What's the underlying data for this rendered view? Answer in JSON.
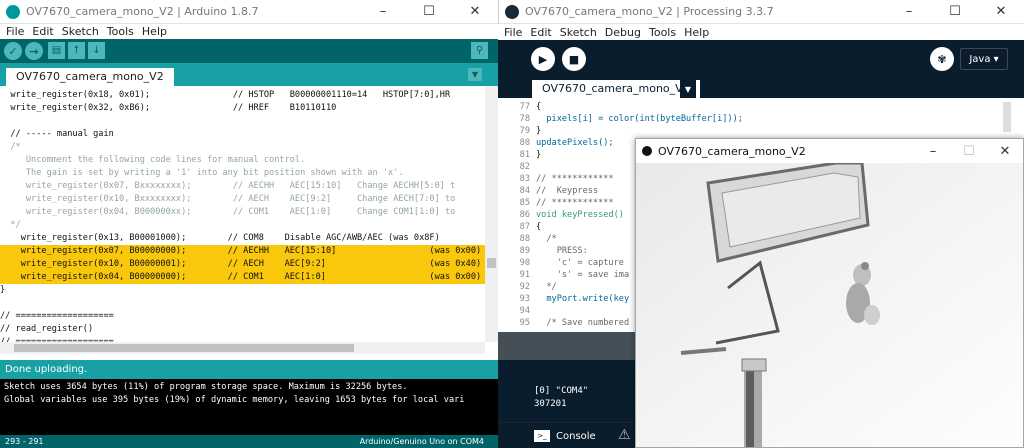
{
  "arduino": {
    "title": "OV7670_camera_mono_V2 | Arduino 1.8.7",
    "menu": [
      "File",
      "Edit",
      "Sketch",
      "Tools",
      "Help"
    ],
    "window_controls": [
      "–",
      "☐",
      "✕"
    ],
    "tab": "OV7670_camera_mono_V2",
    "code_lines": [
      {
        "text": "  write_register(0x18, 0x01);                // HSTOP   B00000001110=14   HSTOP[7:0],HR",
        "style": "code"
      },
      {
        "text": "  write_register(0x32, 0xB6);                // HREF    B10110110",
        "style": "code"
      },
      {
        "text": "",
        "style": "code"
      },
      {
        "text": "  // ----- manual gain",
        "style": "code"
      },
      {
        "text": "  /*",
        "style": "cm"
      },
      {
        "text": "     Uncomment the following code lines for manual control.",
        "style": "cm"
      },
      {
        "text": "     The gain is set by writing a '1' into any bit position shown with an 'x'.",
        "style": "cm"
      },
      {
        "text": "     write_register(0x07, Bxxxxxxxx);        // AECHH   AEC[15:10]   Change AECHH[5:0] t",
        "style": "cm"
      },
      {
        "text": "     write_register(0x10, Bxxxxxxxx);        // AECH    AEC[9:2]     Change AECH[7:0] to",
        "style": "cm"
      },
      {
        "text": "     write_register(0x04, B000000xx);        // COM1    AEC[1:0]     Change COM1[1:0] to",
        "style": "cm"
      },
      {
        "text": "  */",
        "style": "cm"
      },
      {
        "text": "    write_register(0x13, B00001000);        // COM8    Disable AGC/AWB/AEC (was 0x8F)",
        "style": "code"
      },
      {
        "text": "    write_register(0x07, B00000000);        // AECHH   AEC[15:10]                  (was 0x00)",
        "style": "hl"
      },
      {
        "text": "    write_register(0x10, B00000001);        // AECH    AEC[9:2]                    (was 0x40)",
        "style": "hl"
      },
      {
        "text": "    write_register(0x04, B00000000);        // COM1    AEC[1:0]                    (was 0x00)",
        "style": "hl"
      },
      {
        "text": "}",
        "style": "code"
      },
      {
        "text": "",
        "style": "code"
      },
      {
        "text": "// ===================",
        "style": "code"
      },
      {
        "text": "// read_register()",
        "style": "code"
      },
      {
        "text": "// ===================",
        "style": "code"
      }
    ],
    "status": "Done uploading.",
    "console": [
      "Sketch uses 3654 bytes (11%) of program storage space. Maximum is 32256 bytes.",
      "Global variables use 395 bytes (19%) of dynamic memory, leaving 1653 bytes for local vari"
    ],
    "footer_left": "293 - 291",
    "footer_right": "Arduino/Genuino Uno on COM4"
  },
  "processing": {
    "title": "OV7670_camera_mono_V2 | Processing 3.3.7",
    "menu": [
      "File",
      "Edit",
      "Sketch",
      "Debug",
      "Tools",
      "Help"
    ],
    "window_controls": [
      "–",
      "☐",
      "✕"
    ],
    "mode": "Java ▾",
    "tab": "OV7670_camera_mono_V2",
    "code": [
      {
        "ln": "77",
        "text": "{"
      },
      {
        "ln": "78",
        "text": "  pixels[i] = color(int(byteBuffer[i]));"
      },
      {
        "ln": "79",
        "text": "}"
      },
      {
        "ln": "80",
        "text": "updatePixels();"
      },
      {
        "ln": "81",
        "text": "}"
      },
      {
        "ln": "82",
        "text": ""
      },
      {
        "ln": "83",
        "text": "// ************"
      },
      {
        "ln": "84",
        "text": "//  Keypress"
      },
      {
        "ln": "85",
        "text": "// ************"
      },
      {
        "ln": "86",
        "text": "void keyPressed()"
      },
      {
        "ln": "87",
        "text": "{"
      },
      {
        "ln": "88",
        "text": "  /*"
      },
      {
        "ln": "89",
        "text": "    PRESS:"
      },
      {
        "ln": "90",
        "text": "    'c' = capture"
      },
      {
        "ln": "91",
        "text": "    's' = save ima"
      },
      {
        "ln": "92",
        "text": "  */"
      },
      {
        "ln": "93",
        "text": "  myPort.write(key"
      },
      {
        "ln": "94",
        "text": ""
      },
      {
        "ln": "95",
        "text": "  /* Save numbered"
      }
    ],
    "console": [
      "[0] \"COM4\"",
      "307201"
    ],
    "console_button": "Console"
  },
  "sketch_window": {
    "title": "OV7670_camera_mono_V2",
    "window_controls": [
      "–",
      "☐",
      "✕"
    ]
  }
}
